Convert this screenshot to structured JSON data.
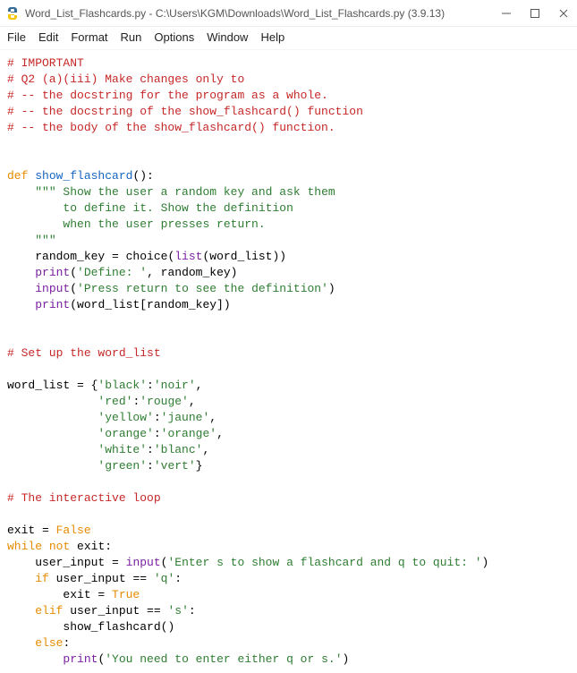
{
  "window": {
    "title": "Word_List_Flashcards.py - C:\\Users\\KGM\\Downloads\\Word_List_Flashcards.py (3.9.13)"
  },
  "menu": {
    "file": "File",
    "edit": "Edit",
    "format": "Format",
    "run": "Run",
    "options": "Options",
    "window": "Window",
    "help": "Help"
  },
  "code": {
    "c01": "# IMPORTANT",
    "c02": "# Q2 (a)(iii) Make changes only to",
    "c03": "# -- the docstring for the program as a whole.",
    "c04": "# -- the docstring of the show_flashcard() function",
    "c05": "# -- the body of the show_flashcard() function.",
    "def": "def",
    "fn_name": "show_flashcard",
    "paren_colon": "():",
    "doc1": "\"\"\" Show the user a random key and ask them",
    "doc2": "to define it. Show the definition",
    "doc3": "when the user presses return.",
    "doc4": "\"\"\"",
    "rk": "random_key = choice(",
    "list": "list",
    "wl1": "(word_list))",
    "print": "print",
    "dstr": "'Define: '",
    "comma_rk": ", random_key)",
    "input": "input",
    "press": "'Press return to see the definition'",
    "close": ")",
    "pwl": "(word_list[random_key])",
    "setcom": "# Set up the word_list",
    "wl_open": "word_list = {",
    "b1": "'black'",
    "b2": "'noir'",
    "r1": "'red'",
    "r2": "'rouge'",
    "y1": "'yellow'",
    "y2": "'jaune'",
    "o1": "'orange'",
    "o2": "'orange'",
    "w1": "'white'",
    "w2": "'blanc'",
    "g1": "'green'",
    "g2": "'vert'",
    "colon": ":",
    "comma": ",",
    "cbrace": "}",
    "intcom": "# The interactive loop",
    "exit_eq": "exit = ",
    "false": "False",
    "while": "while",
    "not": "not",
    "exit_colon": " exit:",
    "ui_eq": "user_input = ",
    "enter": "'Enter s to show a flashcard and q to quit: '",
    "if": "if",
    "ui_q": " user_input == ",
    "q": "'q'",
    "exit_true": "exit = ",
    "true": "True",
    "elif": "elif",
    "s": "'s'",
    "call": "show_flashcard()",
    "else": "else",
    "need": "'You need to enter either q or s.'"
  }
}
